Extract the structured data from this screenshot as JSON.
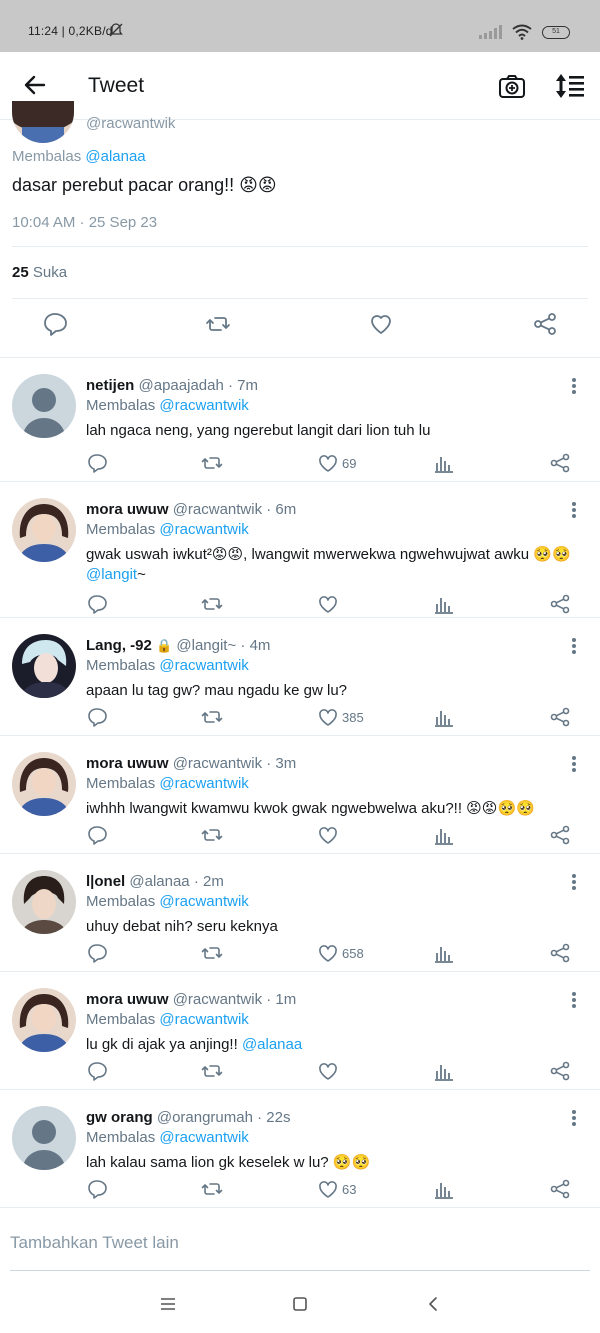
{
  "status_bar": {
    "left_text": "11:24 | 0,2KB/d",
    "battery": "51"
  },
  "header": {
    "title": "Tweet"
  },
  "main_tweet": {
    "handle": "@racwantwik",
    "replying_label": "Membalas",
    "replying_to": "@alanaa",
    "text": "dasar perebut pacar orang!! 😡😡",
    "timestamp": "10:04 AM · 25 Sep 23",
    "likes_count": "25",
    "likes_label": "Suka"
  },
  "replies": [
    {
      "name": "netijen",
      "handle": "@apaajadah · 7m",
      "replying_label": "Membalas",
      "replying_to": "@racwantwik",
      "text": "lah ngaca neng, yang ngerebut langit dari lion tuh lu",
      "text_mention": "",
      "likes": "69"
    },
    {
      "name": "mora uwuw",
      "handle": "@racwantwik · 6m",
      "replying_label": "Membalas",
      "replying_to": "@racwantwik",
      "text": "gwak uswah iwkut²😡😡, lwangwit mwerwekwa ngwehwujwat awku 🥺🥺",
      "text_mention": "@langit",
      "text_after": "~",
      "likes": ""
    },
    {
      "name": "Lang, -92",
      "lock": "🔒",
      "handle": "@langit~ · 4m",
      "replying_label": "Membalas",
      "replying_to": "@racwantwik",
      "text": "apaan lu tag gw? mau ngadu ke gw lu?",
      "text_mention": "",
      "likes": "385"
    },
    {
      "name": "mora uwuw",
      "handle": "@racwantwik · 3m",
      "replying_label": "Membalas",
      "replying_to": "@racwantwik",
      "text": "iwhhh lwangwit kwamwu kwok gwak ngwebwelwa aku?!! 😡😡🥺🥺",
      "text_mention": "",
      "likes": ""
    },
    {
      "name": "l|onel",
      "handle": "@alanaa · 2m",
      "replying_label": "Membalas",
      "replying_to": "@racwantwik",
      "text": "uhuy debat nih? seru keknya",
      "text_mention": "",
      "likes": "658"
    },
    {
      "name": "mora uwuw",
      "handle": "@racwantwik · 1m",
      "replying_label": "Membalas",
      "replying_to": "@racwantwik",
      "text": "lu gk di ajak ya anjing!! ",
      "text_mention": "@alanaa",
      "likes": ""
    },
    {
      "name": "gw orang",
      "handle": "@orangrumah · 22s",
      "replying_label": "Membalas",
      "replying_to": "@racwantwik",
      "text": "lah kalau sama lion gk keselek w lu? 🥺🥺",
      "text_mention": "",
      "likes": "63"
    }
  ],
  "compose": {
    "placeholder": "Tambahkan Tweet lain"
  },
  "colors": {
    "accent": "#1da1f2",
    "secondary_text": "#657786",
    "divider": "#e6ecf0"
  }
}
